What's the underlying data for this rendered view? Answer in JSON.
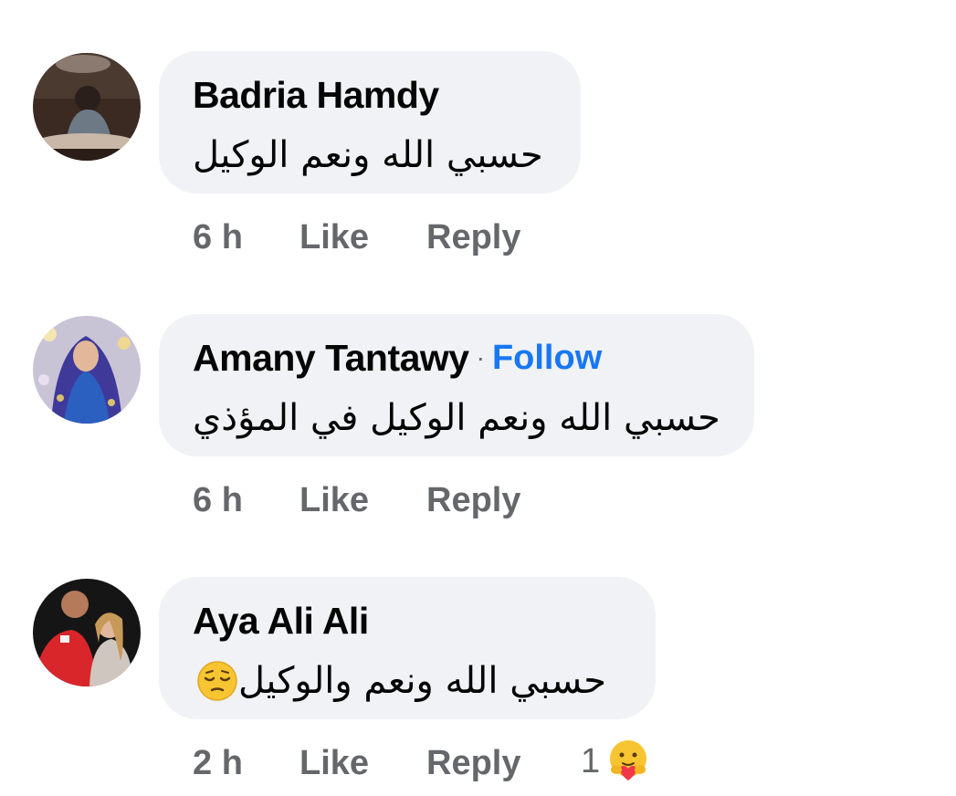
{
  "comments": [
    {
      "author": "Badria Hamdy",
      "text": "حسبي الله ونعم الوكيل",
      "time": "6 h",
      "like_label": "Like",
      "reply_label": "Reply"
    },
    {
      "author": "Amany Tantawy",
      "separator": "·",
      "follow_label": "Follow",
      "text": "حسبي الله ونعم الوكيل في المؤذي",
      "time": "6 h",
      "like_label": "Like",
      "reply_label": "Reply"
    },
    {
      "author": "Aya Ali Ali",
      "text": "حسبي الله ونعم والوكيل",
      "text_emoji": "pensive-face-emoji",
      "time": "2 h",
      "like_label": "Like",
      "reply_label": "Reply",
      "reaction_count": "1",
      "reaction_icon": "care-reaction-icon"
    }
  ],
  "colors": {
    "bubble": "#f0f2f5",
    "name": "#050505",
    "meta": "#65676b",
    "follow": "#1877f2"
  }
}
